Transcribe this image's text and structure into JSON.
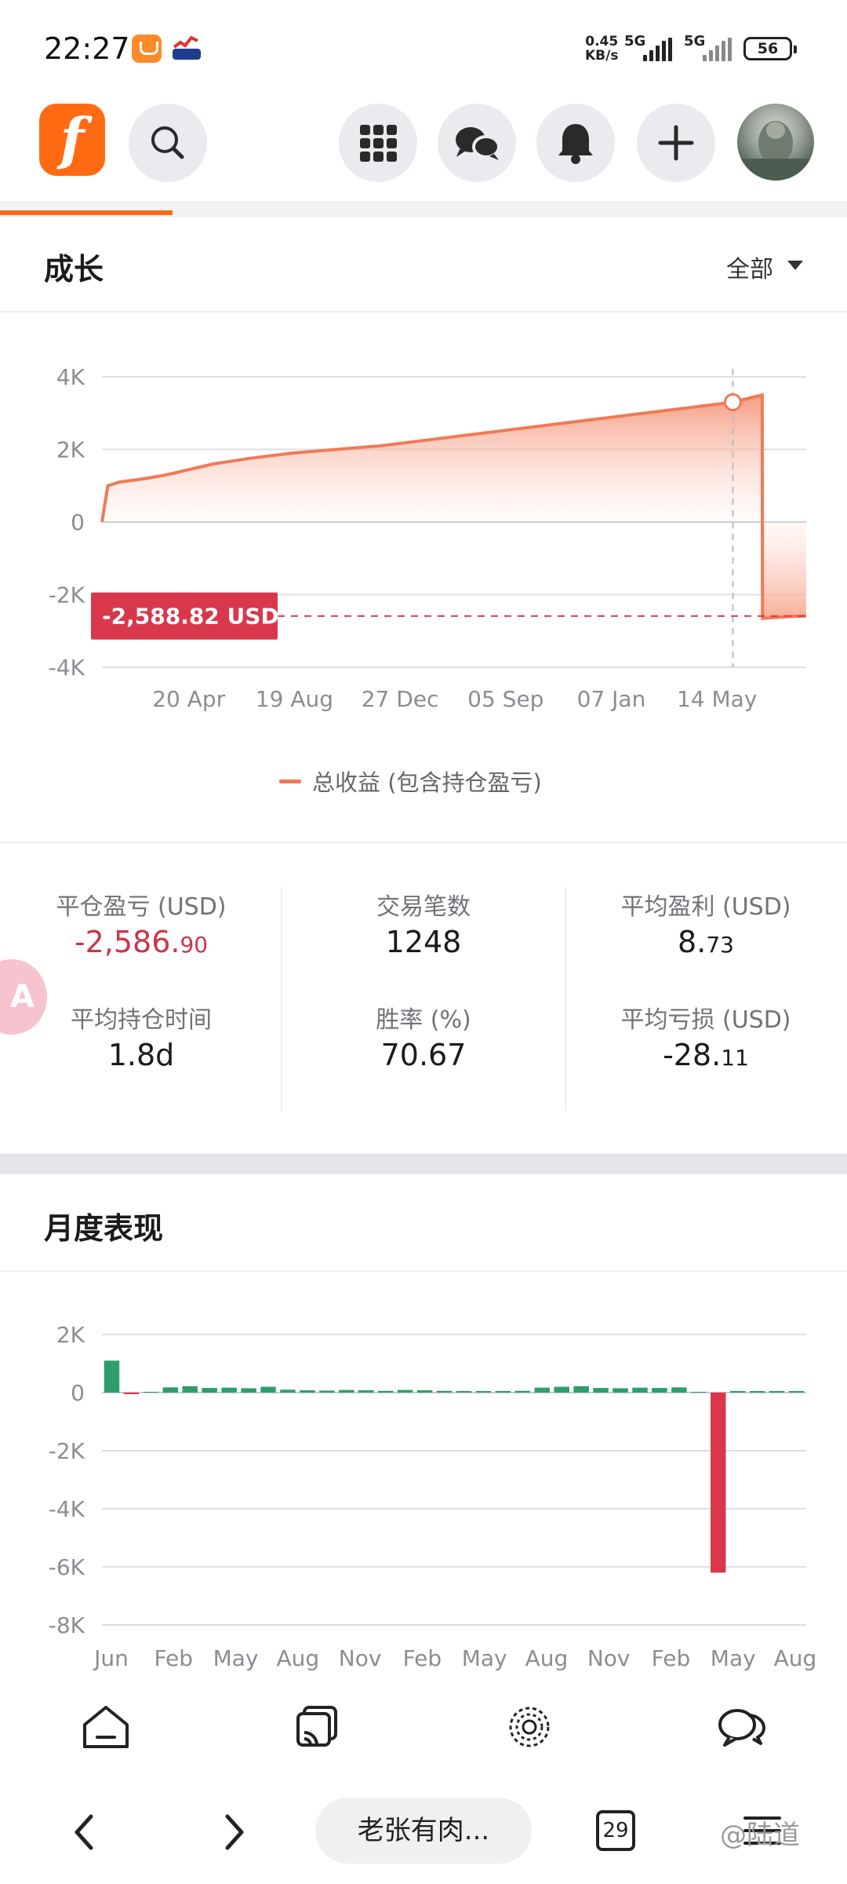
{
  "status_bar": {
    "time": "22:27",
    "net_speed": "0.45",
    "net_unit": "KB/s",
    "sim1": "5G",
    "sim2": "5G",
    "battery": "56"
  },
  "app_bar": {
    "logo_letter": "f",
    "icons": [
      "search-icon",
      "grid-apps-icon",
      "chat-bubbles-icon",
      "bell-icon",
      "plus-icon",
      "avatar"
    ]
  },
  "growth": {
    "title": "成长",
    "filter_label": "全部",
    "current_label": "-2,588.82 USD",
    "legend": "总收益 (包含持仓盈亏)",
    "accent": "#f07a55",
    "negative": "#d9384c"
  },
  "stats": {
    "closed_pnl_label": "平仓盈亏 (USD)",
    "closed_pnl_main": "-2,586.",
    "closed_pnl_dec": "90",
    "trades_label": "交易笔数",
    "trades_value": "1248",
    "avg_profit_label": "平均盈利 (USD)",
    "avg_profit_main": "8.",
    "avg_profit_dec": "73",
    "avg_hold_label": "平均持仓时间",
    "avg_hold_value": "1.8d",
    "win_rate_label": "胜率 (%)",
    "win_rate_value": "70.67",
    "avg_loss_label": "平均亏损 (USD)",
    "avg_loss_main": "-28.",
    "avg_loss_dec": "11",
    "float_badge": "A"
  },
  "monthly": {
    "title": "月度表现",
    "positive_color": "#2e9e6e",
    "negative_color": "#d9384c"
  },
  "chart_data": [
    {
      "type": "area",
      "title": "成长",
      "y_ticks": [
        "4K",
        "2K",
        "0",
        "-2K",
        "-4K"
      ],
      "x_ticks": [
        "20 Apr",
        "19 Aug",
        "27 Dec",
        "05 Sep",
        "07 Jan",
        "14 May"
      ],
      "ylim": [
        -4000,
        4000
      ],
      "series": [
        {
          "name": "总收益 (包含持仓盈亏)",
          "x": [
            0,
            0.2,
            0.6,
            1.5,
            2.2,
            3.0,
            3.8,
            5.0,
            6.5,
            8.0,
            9.5,
            11.0,
            12.5,
            14.0,
            15.5,
            17.0,
            18.5,
            20.0,
            21.5,
            22.0,
            22.5,
            22.51,
            23.5,
            24.0
          ],
          "y": [
            0,
            1000,
            1100,
            1200,
            1300,
            1450,
            1600,
            1750,
            1900,
            2000,
            2100,
            2250,
            2400,
            2550,
            2700,
            2850,
            3000,
            3150,
            3300,
            3400,
            3500,
            -2650,
            -2600,
            -2590
          ]
        }
      ],
      "marker_value": 3300,
      "current_value": -2588.82,
      "grid": true,
      "legend_position": "bottom"
    },
    {
      "type": "bar",
      "title": "月度表现",
      "y_ticks": [
        "2K",
        "0",
        "-2K",
        "-4K",
        "-6K",
        "-8K"
      ],
      "x_ticks": [
        "Jun",
        "Feb",
        "May",
        "Aug",
        "Nov",
        "Feb",
        "May",
        "Aug",
        "Nov",
        "Feb",
        "May",
        "Aug"
      ],
      "ylim": [
        -8000,
        2000
      ],
      "values": [
        1100,
        -50,
        0,
        180,
        220,
        160,
        170,
        150,
        200,
        100,
        80,
        70,
        90,
        80,
        60,
        90,
        80,
        60,
        40,
        50,
        40,
        60,
        170,
        200,
        220,
        160,
        150,
        170,
        160,
        180,
        0,
        -6200,
        40,
        30,
        20,
        10
      ],
      "grid": true
    }
  ],
  "bottom_nav": {
    "icons": [
      "home-icon",
      "cast-icon",
      "discover-icon",
      "chat-icon"
    ]
  },
  "browser_bar": {
    "url_text": "老张有肉...",
    "tab_count": "29",
    "watermark": "@陆道"
  }
}
